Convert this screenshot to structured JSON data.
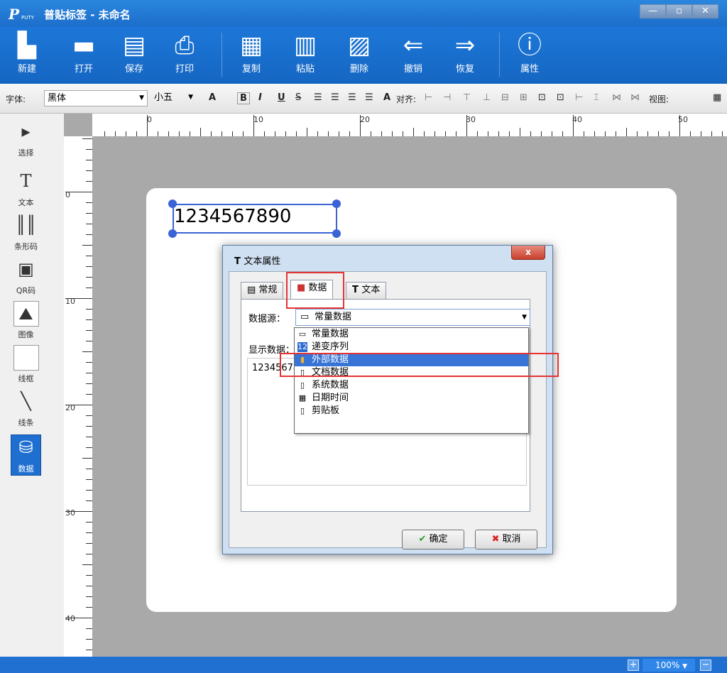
{
  "app": {
    "title": "普贴标签 - 未命名",
    "logo_text": "P",
    "logo_sub": "PUTY"
  },
  "window_controls": [
    "—",
    "▫",
    "✕"
  ],
  "toolbar": [
    {
      "label": "新建",
      "icon": "new-file-icon"
    },
    {
      "label": "打开",
      "icon": "folder-open-icon"
    },
    {
      "label": "保存",
      "icon": "save-icon"
    },
    {
      "label": "打印",
      "icon": "printer-icon"
    },
    {
      "label": "复制",
      "icon": "copy-icon"
    },
    {
      "label": "粘贴",
      "icon": "paste-icon"
    },
    {
      "label": "删除",
      "icon": "trash-icon"
    },
    {
      "label": "撤销",
      "icon": "undo-arrow-icon"
    },
    {
      "label": "恢复",
      "icon": "redo-arrow-icon"
    },
    {
      "label": "属性",
      "icon": "info-icon"
    }
  ],
  "format_bar": {
    "font_label": "字体:",
    "font_value": "黑体",
    "size_value": "小五",
    "align_label": "对齐:",
    "view_label": "视图:"
  },
  "left_tools": [
    {
      "label": "选择",
      "icon": "select-cursor-icon"
    },
    {
      "label": "文本",
      "icon": "text-icon"
    },
    {
      "label": "条形码",
      "icon": "barcode-icon"
    },
    {
      "label": "QR码",
      "icon": "qrcode-icon"
    },
    {
      "label": "图像",
      "icon": "image-icon"
    },
    {
      "label": "线框",
      "icon": "rectangle-icon"
    },
    {
      "label": "线条",
      "icon": "line-icon"
    },
    {
      "label": "数据",
      "icon": "database-icon"
    }
  ],
  "ruler": {
    "h_labels": [
      "0",
      "10",
      "20",
      "30",
      "40",
      "50"
    ],
    "v_labels": [
      "0",
      "10",
      "20",
      "30",
      "40"
    ]
  },
  "canvas": {
    "sample_text": "1234567890"
  },
  "dialog": {
    "title": "文本属性",
    "close": "x",
    "tabs": [
      {
        "label": "常规"
      },
      {
        "label": "数据"
      },
      {
        "label": "文本"
      }
    ],
    "data_source_label": "数据源：",
    "data_source_value": "常量数据",
    "display_label": "显示数据：",
    "display_value": "1234567890",
    "ok": "确定",
    "cancel": "取消"
  },
  "dropdown": [
    "常量数据",
    "递变序列",
    "外部数据",
    "文档数据",
    "系统数据",
    "日期时间",
    "剪贴板"
  ],
  "status": {
    "zoom": "100%"
  }
}
